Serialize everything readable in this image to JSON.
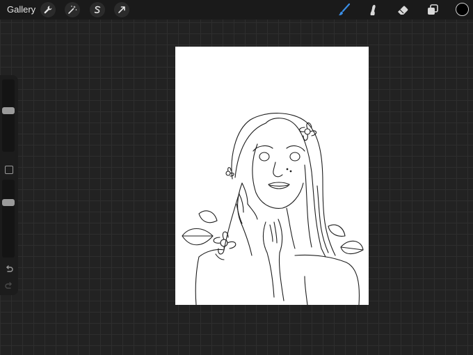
{
  "topbar": {
    "gallery_label": "Gallery",
    "left_tools": [
      "wrench-icon",
      "magic-wand-icon",
      "selection-icon",
      "transform-arrow-icon"
    ],
    "right_tools": [
      "brush-icon",
      "smudge-icon",
      "eraser-icon",
      "layers-icon"
    ],
    "active_tool": "brush-icon",
    "active_color": "#000000",
    "accent_color": "#3a8ee6"
  },
  "sidebar": {
    "brush_size_level": 0.43,
    "brush_opacity_level": 0.27,
    "icons": [
      "modify-square-icon",
      "undo-icon",
      "redo-icon"
    ]
  },
  "canvas": {
    "background": "#ffffff",
    "content": "line-art-sketch"
  }
}
